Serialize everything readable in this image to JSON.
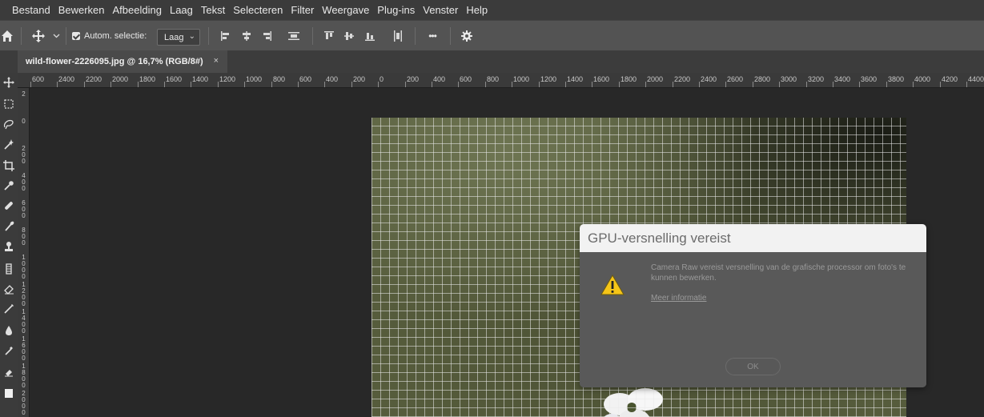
{
  "menubar": {
    "items": [
      "Bestand",
      "Bewerken",
      "Afbeelding",
      "Laag",
      "Tekst",
      "Selecteren",
      "Filter",
      "Weergave",
      "Plug-ins",
      "Venster",
      "Help"
    ]
  },
  "options": {
    "auto_select_label": "Autom. selectie:",
    "auto_select_checked": true,
    "auto_select_target": "Laag",
    "more_label": "•••"
  },
  "document_tab": {
    "title": "wild-flower-2226095.jpg @ 16,7% (RGB/8#)",
    "close_label": "×"
  },
  "ruler": {
    "horizontal_labels": [
      "600",
      "2400",
      "2200",
      "2000",
      "1800",
      "1600",
      "1400",
      "1200",
      "1000",
      "800",
      "600",
      "400",
      "200",
      "0",
      "200",
      "400",
      "600",
      "800",
      "1000",
      "1200",
      "1400",
      "1600",
      "1800",
      "2000",
      "2200",
      "2400",
      "2600",
      "2800",
      "3000",
      "3200",
      "3400",
      "3600",
      "3800",
      "4000",
      "4200",
      "4400"
    ],
    "vertical_labels": [
      "2",
      "0",
      "2\n0\n0",
      "4\n0\n0",
      "6\n0\n0",
      "8\n0\n0",
      "1\n0\n0\n0",
      "1\n2\n0\n0",
      "1\n4\n0\n0",
      "1\n6\n0\n0",
      "1\n8\n0\n0",
      "2\n0\n0\n0"
    ]
  },
  "dialog": {
    "title": "GPU-versnelling vereist",
    "message": "Camera Raw vereist versnelling van de grafische processor om foto's te kunnen bewerken.",
    "link": "Meer informatie",
    "ok_label": "OK"
  },
  "colors": {
    "menubar_bg": "#3b3b3b",
    "optionsbar_bg": "#535353",
    "workspace_bg": "#282828",
    "dialog_title_bg": "#f2f2f2",
    "dialog_body_bg": "#595959",
    "warning_yellow": "#f5c518"
  }
}
